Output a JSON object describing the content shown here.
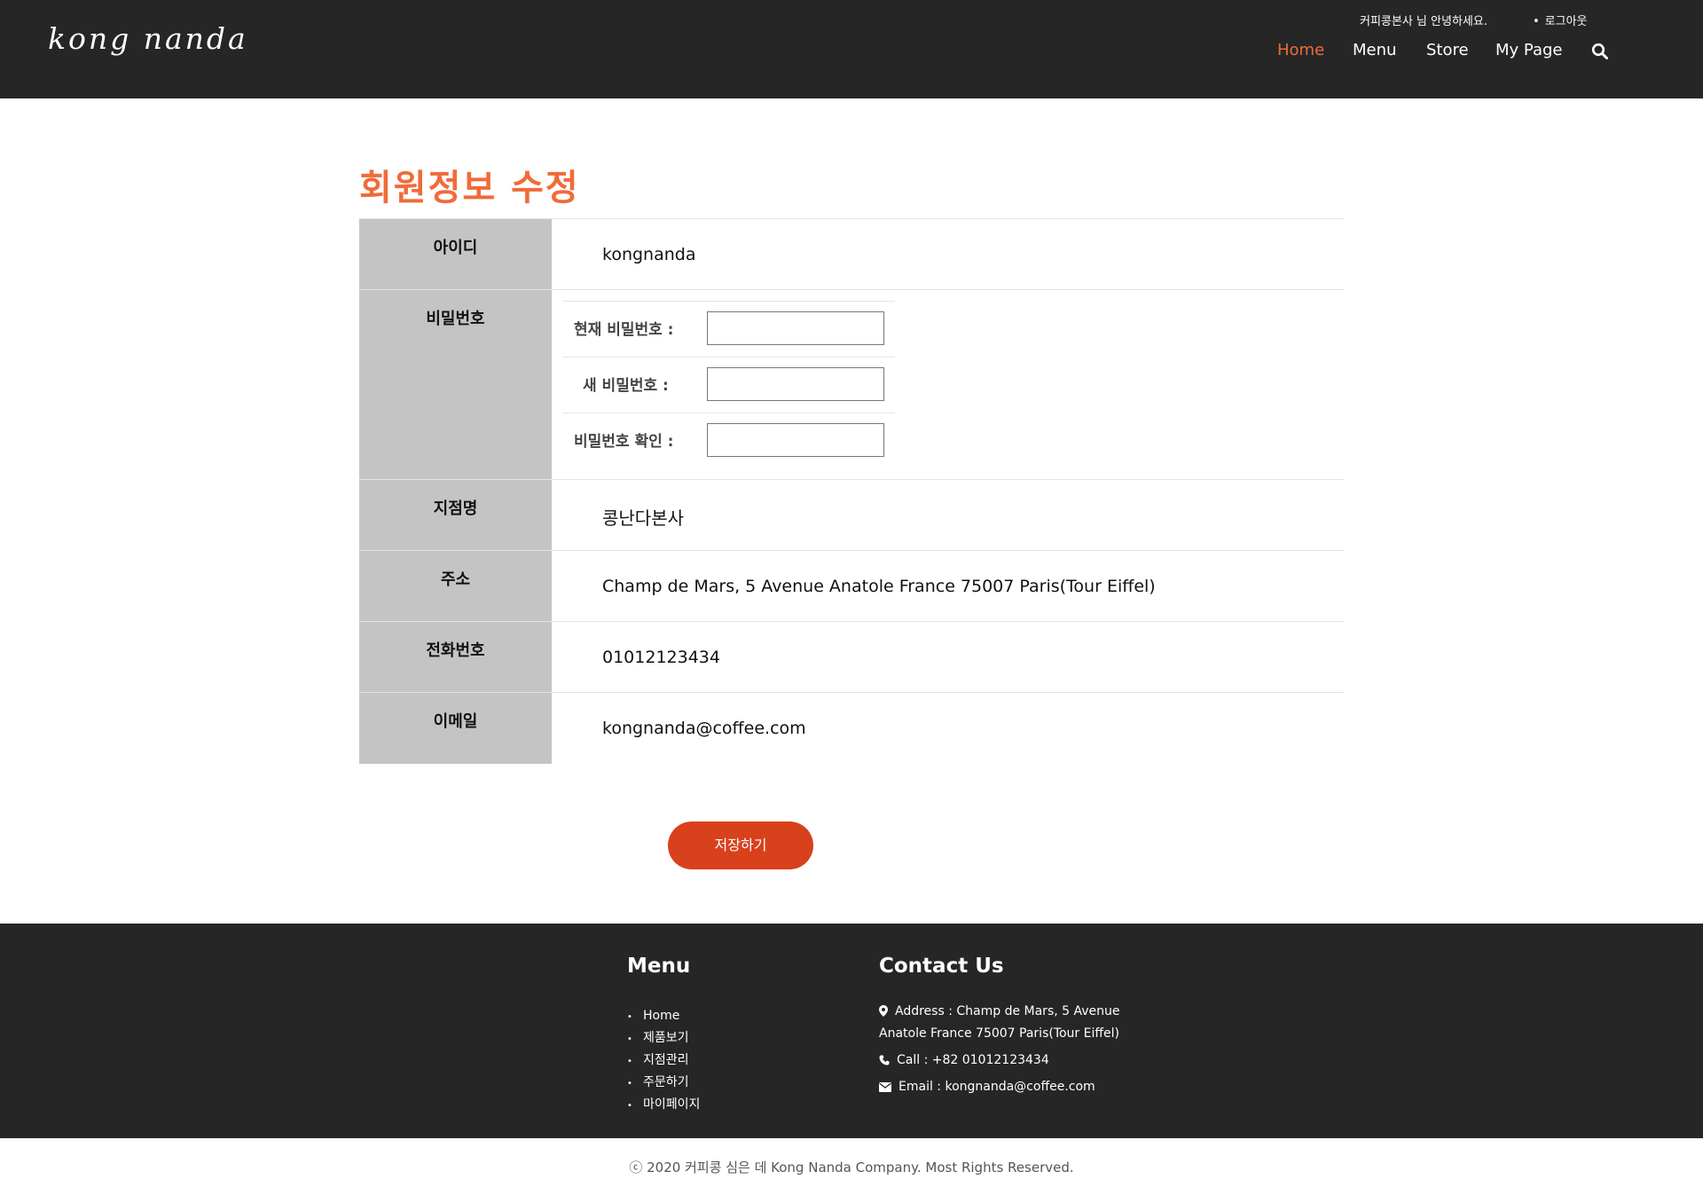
{
  "header": {
    "logo_text": "kong nanda",
    "greeting": "커피콩본사 님 안녕하세요.",
    "logout_label": "로그아웃",
    "nav": [
      {
        "label": "Home",
        "active": true
      },
      {
        "label": "Menu",
        "active": false
      },
      {
        "label": "Store",
        "active": false
      },
      {
        "label": "My Page",
        "active": false
      }
    ],
    "search_icon": "search-icon"
  },
  "page_title": "회원정보 수정",
  "form": {
    "id_label": "아이디",
    "id_value": "kongnanda",
    "password_label": "비밀번호",
    "current_pw_label": "현재 비밀번호 :",
    "current_pw_value": "",
    "new_pw_label": "새 비밀번호 :",
    "new_pw_value": "",
    "confirm_pw_label": "비밀번호 확인 :",
    "confirm_pw_value": "",
    "branch_label": "지점명",
    "branch_value": "콩난다본사",
    "address_label": "주소",
    "address_value": "Champ de Mars, 5 Avenue Anatole France 75007 Paris(Tour Eiffel)",
    "phone_label": "전화번호",
    "phone_value": "01012123434",
    "email_label": "이메일",
    "email_value": "kongnanda@coffee.com"
  },
  "save_label": "저장하기",
  "footer": {
    "menu_heading": "Menu",
    "menu_items": [
      "Home",
      "제품보기",
      "지점관리",
      "주문하기",
      "마이페이지"
    ],
    "contact_heading": "Contact Us",
    "address_line1": "Address : Champ de Mars, 5 Avenue",
    "address_line2": "Anatole France 75007 Paris(Tour Eiffel)",
    "call": "Call : +82 01012123434",
    "email": "Email : kongnanda@coffee.com"
  },
  "copyright": "ⓒ 2020 커피콩 심은 데 Kong Nanda Company. Most Rights Reserved.",
  "colors": {
    "accent": "#f06b3a",
    "header_bg": "#262626",
    "label_bg": "#c4c4c4",
    "save_button": "#d9401c"
  }
}
